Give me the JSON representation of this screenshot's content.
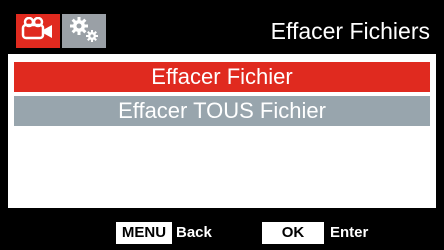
{
  "header": {
    "title": "Effacer Fichiers",
    "tabs": [
      {
        "icon": "video-camera-icon",
        "selected": true
      },
      {
        "icon": "settings-gears-icon",
        "selected": false
      }
    ]
  },
  "menu": {
    "items": [
      {
        "label": "Effacer Fichier",
        "selected": true
      },
      {
        "label": "Effacer TOUS Fichier",
        "selected": false
      }
    ]
  },
  "footer": {
    "menu_key": "MENU",
    "menu_action": "Back",
    "ok_key": "OK",
    "ok_action": "Enter"
  },
  "colors": {
    "accent": "#e02a1f",
    "inactive": "#98a5ad",
    "background": "#000000",
    "panel": "#ffffff"
  }
}
